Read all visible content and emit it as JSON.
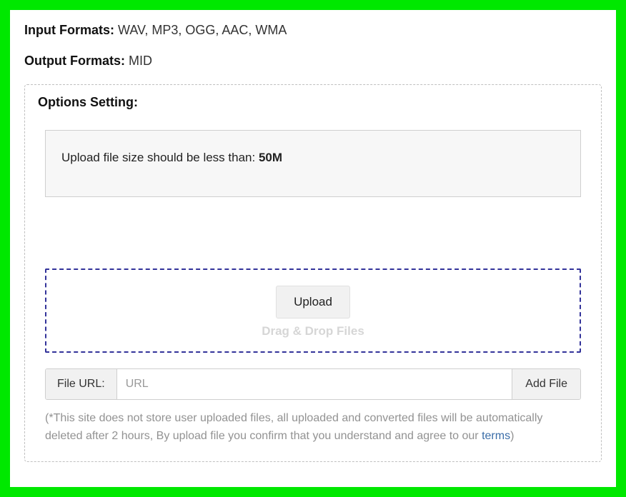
{
  "formats": {
    "input_label": "Input Formats: ",
    "input_value": "WAV, MP3, OGG, AAC, WMA",
    "output_label": "Output Formats: ",
    "output_value": "MID"
  },
  "options": {
    "title": "Options Setting:",
    "size_notice_text": "Upload file size should be less than: ",
    "size_limit": "50M"
  },
  "upload": {
    "button_label": "Upload",
    "drag_hint": "Drag & Drop Files"
  },
  "url": {
    "label": "File URL:",
    "placeholder": "URL",
    "add_button": "Add File"
  },
  "disclaimer": {
    "prefix": "(*",
    "text": "This site does not store user uploaded files, all uploaded and converted files will be automatically deleted after 2 hours, By upload file you confirm that you understand and agree to our ",
    "terms_label": "terms",
    "suffix": ")"
  }
}
